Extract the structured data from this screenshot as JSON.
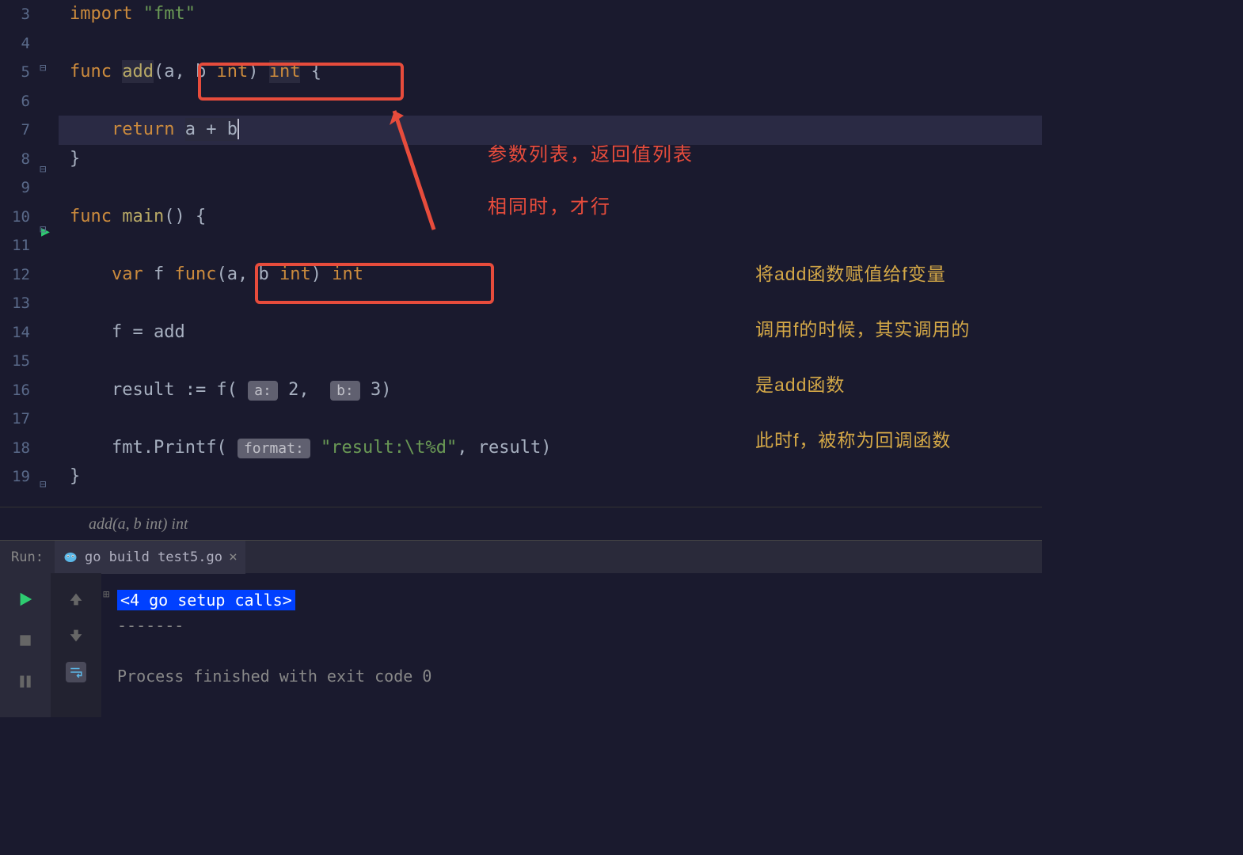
{
  "gutter": [
    "3",
    "4",
    "5",
    "6",
    "7",
    "8",
    "9",
    "10",
    "11",
    "12",
    "13",
    "14",
    "15",
    "16",
    "17",
    "18",
    "19"
  ],
  "code": {
    "l3": {
      "kw": "import",
      "str": "\"fmt\""
    },
    "l5": {
      "kw": "func",
      "fn": "add",
      "params": "(a, b ",
      "typ1": "int",
      "paren": ") ",
      "typ2": "int",
      "brace": " {"
    },
    "l7": {
      "kw": "return",
      "expr": "a + b"
    },
    "l8": {
      "brace": "}"
    },
    "l10": {
      "kw": "func",
      "fn": "main",
      "rest": "() {"
    },
    "l12": {
      "kw": "var",
      "ident": " f ",
      "fkw": "func",
      "params": "(a, b ",
      "typ1": "int",
      "paren": ") ",
      "typ2": "int"
    },
    "l14": {
      "text": "f = add"
    },
    "l16": {
      "text1": "result := f( ",
      "hint1": "a:",
      "text2": " 2,  ",
      "hint2": "b:",
      "text3": " 3)"
    },
    "l18": {
      "text1": "fmt.Printf( ",
      "hint": "format:",
      "text2": " ",
      "str": "\"result:\\t%d\"",
      "text3": ", result)"
    },
    "l19": {
      "brace": "}"
    }
  },
  "annotations": {
    "red1": "参数列表，返回值列表",
    "red2": "相同时，才行",
    "gold1": "将add函数赋值给f变量",
    "gold2": "调用f的时候，其实调用的",
    "gold3": "是add函数",
    "gold4": "此时f，被称为回调函数"
  },
  "breadcrumb": "add(a, b int) int",
  "runPanel": {
    "label": "Run:",
    "tab": "go build test5.go"
  },
  "console": {
    "setup": "<4 go setup calls>",
    "sep": "-------",
    "exit": "Process finished with exit code 0"
  }
}
